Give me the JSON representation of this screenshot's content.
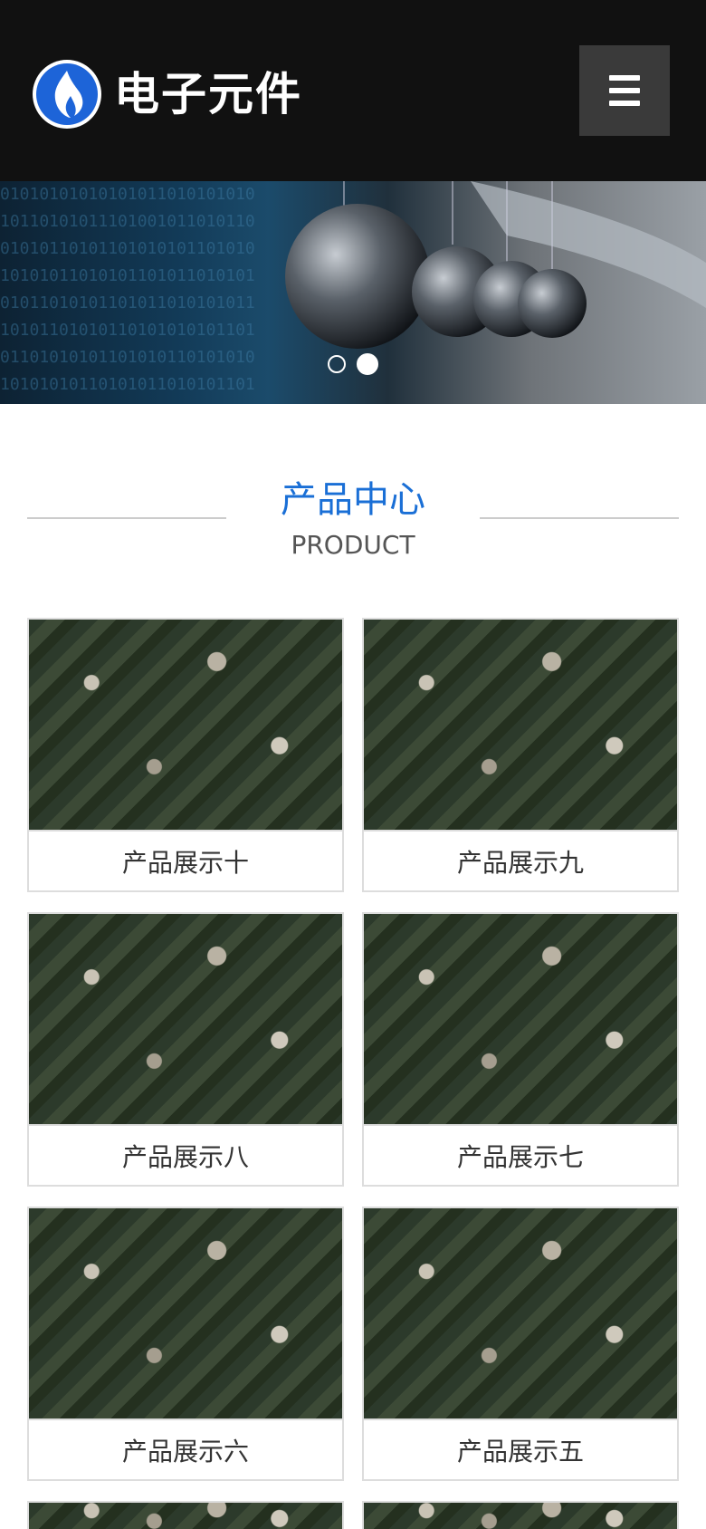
{
  "header": {
    "brand": "电子元件",
    "logo_icon": "flame-logo-icon",
    "menu_icon": "hamburger-menu-icon",
    "background": "#111111"
  },
  "banner": {
    "slides": 2,
    "active_slide": 2
  },
  "section": {
    "title_cn": "产品中心",
    "title_en": "PRODUCT",
    "title_color": "#1a6fd6"
  },
  "products": [
    {
      "label": "产品展示十"
    },
    {
      "label": "产品展示九"
    },
    {
      "label": "产品展示八"
    },
    {
      "label": "产品展示七"
    },
    {
      "label": "产品展示六"
    },
    {
      "label": "产品展示五"
    }
  ]
}
